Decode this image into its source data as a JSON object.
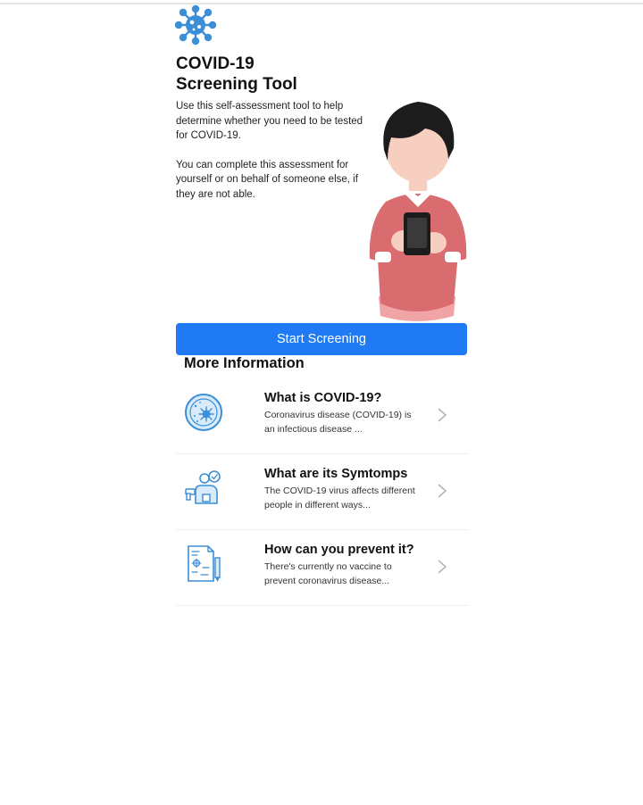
{
  "header": {
    "logo_icon": "virus-icon",
    "title_line1": "COVID-19",
    "title_line2": "Screening Tool"
  },
  "intro": {
    "paragraph1": "Use this self-assessment tool to help determine whether you need to be tested for COVID-19.",
    "paragraph2": "You can complete this assessment for yourself or on behalf of someone else, if they are not able."
  },
  "illustration_icon": "person-with-phone-illustration",
  "start_button_label": "Start Screening",
  "more_info": {
    "title": "More Information",
    "items": [
      {
        "icon": "virus-petri-dish-icon",
        "title": "What is COVID-19?",
        "description": "Coronavirus disease (COVID-19) is an infectious disease ..."
      },
      {
        "icon": "symptoms-thermometer-icon",
        "title": "What are its Symtomps",
        "description": "The COVID-19 virus affects different people in different ways..."
      },
      {
        "icon": "prevention-clipboard-icon",
        "title": "How can you prevent it?",
        "description": "There's currently no vaccine to prevent coronavirus disease..."
      }
    ]
  },
  "colors": {
    "accent": "#1f7af3",
    "icon_blue": "#3b8fd6",
    "sweater": "#d96c6f",
    "hair": "#1c1c1c"
  }
}
